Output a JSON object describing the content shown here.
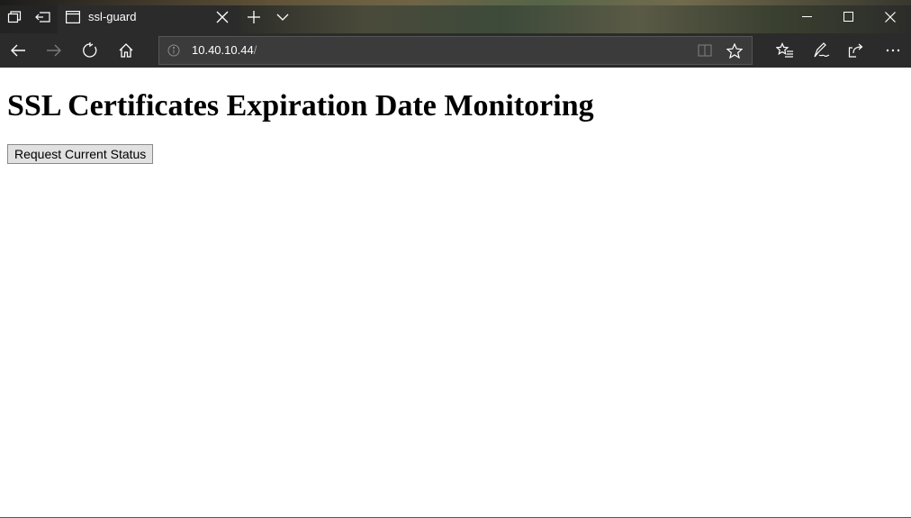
{
  "browser": {
    "tab": {
      "title": "ssl-guard"
    },
    "address_bar": {
      "url_host": "10.40.10.44",
      "url_path": "/"
    },
    "titlebar_icons": [
      "tab-actions-icon",
      "set-aside-tabs-icon"
    ],
    "new_tab_icon": "plus-icon",
    "tab_list_icon": "chevron-down-icon",
    "window_controls": [
      "minimize-icon",
      "maximize-icon",
      "close-icon"
    ],
    "nav_icons": [
      "back-arrow-icon",
      "forward-arrow-icon",
      "refresh-icon",
      "home-icon"
    ],
    "toolbar_icons": [
      "favorites-list-icon",
      "pen-icon",
      "share-icon",
      "more-icon"
    ]
  },
  "page": {
    "heading": "SSL Certificates Expiration Date Monitoring",
    "button_label": "Request Current Status"
  }
}
